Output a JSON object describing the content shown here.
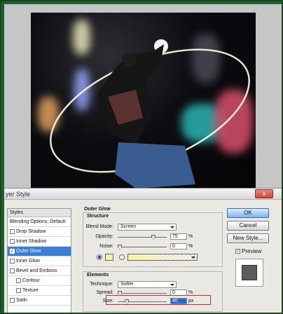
{
  "dialog": {
    "title": "yer Style",
    "close_symbol": "x"
  },
  "styles": {
    "header": "Styles",
    "items": [
      {
        "label": "Blending Options: Default",
        "checkbox": false,
        "checked": false,
        "indent": false,
        "active": false
      },
      {
        "label": "Drop Shadow",
        "checkbox": true,
        "checked": false,
        "indent": false,
        "active": false
      },
      {
        "label": "Inner Shadow",
        "checkbox": true,
        "checked": false,
        "indent": false,
        "active": false
      },
      {
        "label": "Outer Glow",
        "checkbox": true,
        "checked": true,
        "indent": false,
        "active": true
      },
      {
        "label": "Inner Glow",
        "checkbox": true,
        "checked": false,
        "indent": false,
        "active": false
      },
      {
        "label": "Bevel and Emboss",
        "checkbox": true,
        "checked": false,
        "indent": false,
        "active": false
      },
      {
        "label": "Contour",
        "checkbox": true,
        "checked": false,
        "indent": true,
        "active": false
      },
      {
        "label": "Texture",
        "checkbox": true,
        "checked": false,
        "indent": true,
        "active": false
      },
      {
        "label": "Satin",
        "checkbox": true,
        "checked": false,
        "indent": false,
        "active": false
      }
    ]
  },
  "outer_glow": {
    "heading": "Outer Glow",
    "structure": {
      "heading": "Structure",
      "blend_mode_label": "Blend Mode:",
      "blend_mode_value": "Screen",
      "opacity_label": "Opacity:",
      "opacity_value": "75",
      "opacity_unit": "%",
      "opacity_level": 0.75,
      "noise_label": "Noise:",
      "noise_value": "0",
      "noise_unit": "%",
      "noise_level": 0.0,
      "glow_color": "#f7f4a8"
    },
    "elements": {
      "heading": "Elements",
      "technique_label": "Technique:",
      "technique_value": "Softer",
      "spread_label": "Spread:",
      "spread_value": "0",
      "spread_unit": "%",
      "spread_level": 0.0,
      "size_label": "Size:",
      "size_value": "40",
      "size_unit": "px",
      "size_level": 0.16
    }
  },
  "buttons": {
    "ok": "OK",
    "cancel": "Cancel",
    "new_style": "New Style...",
    "preview_label": "Preview",
    "preview_checked": true
  }
}
